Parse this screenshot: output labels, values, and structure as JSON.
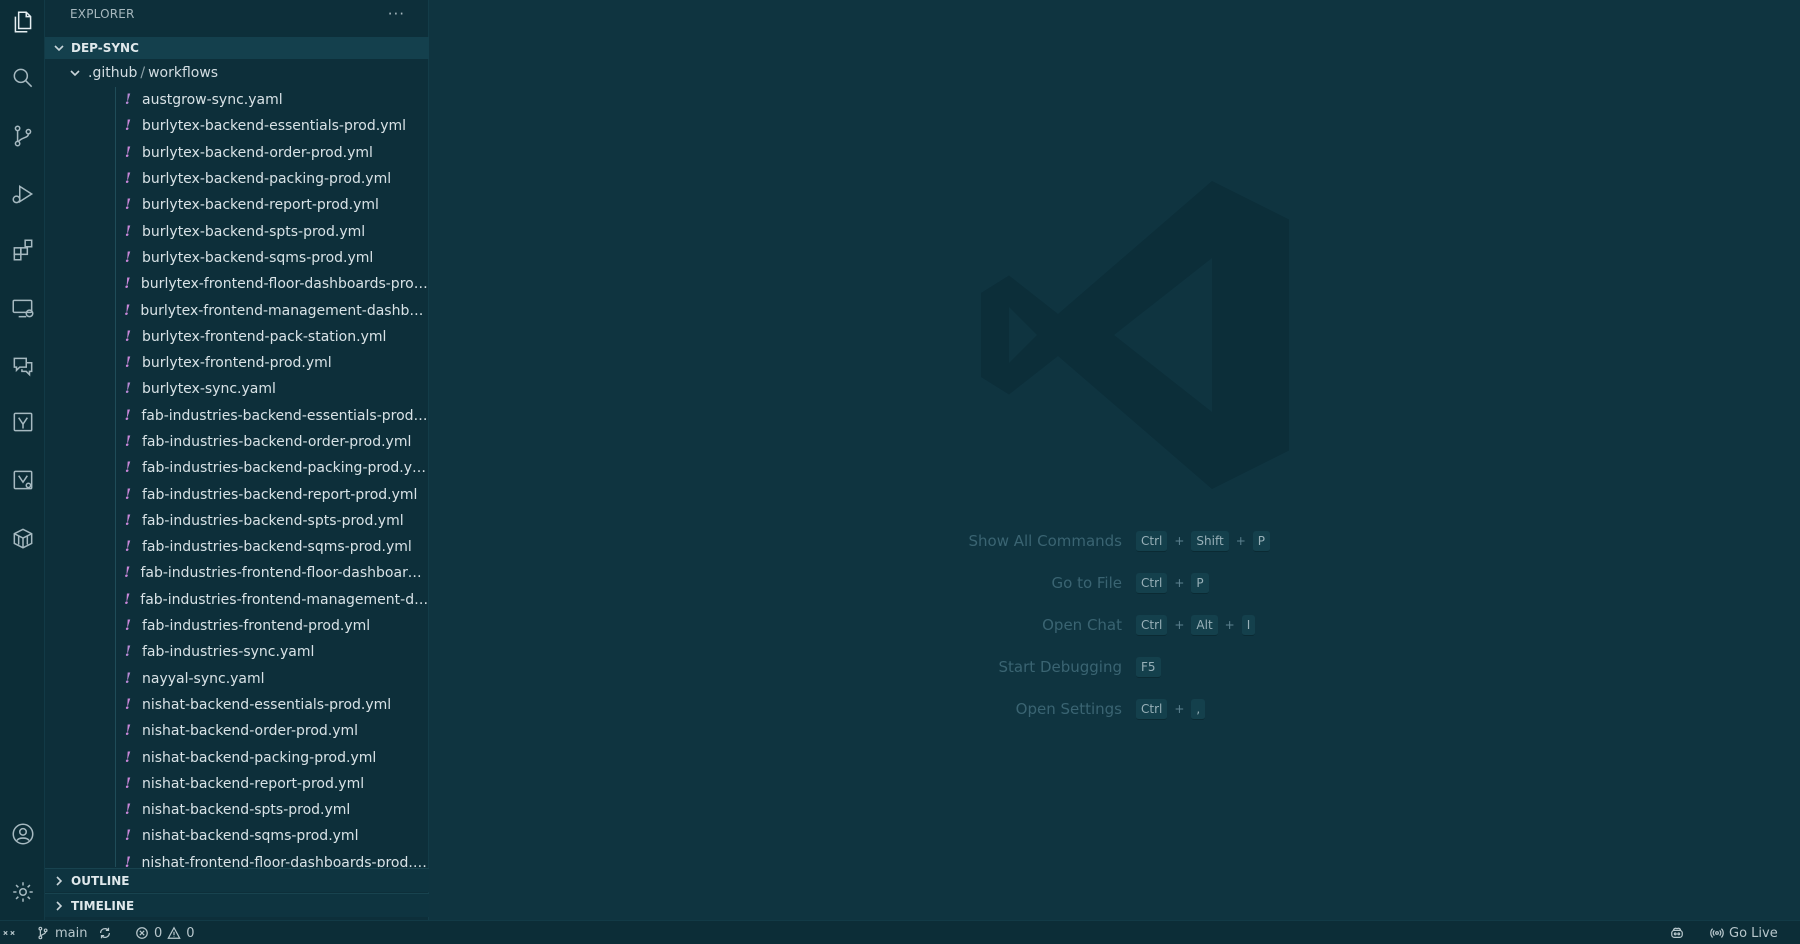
{
  "sidebar": {
    "title": "EXPLORER",
    "more_label": "···",
    "root_folder": "DEP-SYNC",
    "subfolder": {
      "part1": ".github",
      "sep": "/",
      "part2": "workflows"
    },
    "files": [
      {
        "name": "austgrow-sync.yaml",
        "type": "yaml"
      },
      {
        "name": "burlytex-backend-essentials-prod.yml",
        "type": "yml"
      },
      {
        "name": "burlytex-backend-order-prod.yml",
        "type": "yml"
      },
      {
        "name": "burlytex-backend-packing-prod.yml",
        "type": "yml"
      },
      {
        "name": "burlytex-backend-report-prod.yml",
        "type": "yml"
      },
      {
        "name": "burlytex-backend-spts-prod.yml",
        "type": "yml"
      },
      {
        "name": "burlytex-backend-sqms-prod.yml",
        "type": "yml"
      },
      {
        "name": "burlytex-frontend-floor-dashboards-prod.yml",
        "type": "yml"
      },
      {
        "name": "burlytex-frontend-management-dashboards-...",
        "type": "yml"
      },
      {
        "name": "burlytex-frontend-pack-station.yml",
        "type": "yml"
      },
      {
        "name": "burlytex-frontend-prod.yml",
        "type": "yml"
      },
      {
        "name": "burlytex-sync.yaml",
        "type": "yaml"
      },
      {
        "name": "fab-industries-backend-essentials-prod.yml",
        "type": "yml"
      },
      {
        "name": "fab-industries-backend-order-prod.yml",
        "type": "yml"
      },
      {
        "name": "fab-industries-backend-packing-prod.yml",
        "type": "yml"
      },
      {
        "name": "fab-industries-backend-report-prod.yml",
        "type": "yml"
      },
      {
        "name": "fab-industries-backend-spts-prod.yml",
        "type": "yml"
      },
      {
        "name": "fab-industries-backend-sqms-prod.yml",
        "type": "yml"
      },
      {
        "name": "fab-industries-frontend-floor-dashboards-pro...",
        "type": "yml"
      },
      {
        "name": "fab-industries-frontend-management-dashbo...",
        "type": "yml"
      },
      {
        "name": "fab-industries-frontend-prod.yml",
        "type": "yml"
      },
      {
        "name": "fab-industries-sync.yaml",
        "type": "yaml"
      },
      {
        "name": "nayyal-sync.yaml",
        "type": "yaml"
      },
      {
        "name": "nishat-backend-essentials-prod.yml",
        "type": "yml"
      },
      {
        "name": "nishat-backend-order-prod.yml",
        "type": "yml"
      },
      {
        "name": "nishat-backend-packing-prod.yml",
        "type": "yml"
      },
      {
        "name": "nishat-backend-report-prod.yml",
        "type": "yml"
      },
      {
        "name": "nishat-backend-spts-prod.yml",
        "type": "yml"
      },
      {
        "name": "nishat-backend-sqms-prod.yml",
        "type": "yml"
      },
      {
        "name": "nishat-frontend-floor-dashboards-prod.yml",
        "type": "yml"
      }
    ],
    "file_icon_glyph": "!",
    "outline_label": "OUTLINE",
    "timeline_label": "TIMELINE"
  },
  "editor": {
    "shortcuts": [
      {
        "label": "Show All Commands",
        "keys": [
          "Ctrl",
          "Shift",
          "P"
        ]
      },
      {
        "label": "Go to File",
        "keys": [
          "Ctrl",
          "P"
        ]
      },
      {
        "label": "Open Chat",
        "keys": [
          "Ctrl",
          "Alt",
          "I"
        ]
      },
      {
        "label": "Start Debugging",
        "keys": [
          "F5"
        ]
      },
      {
        "label": "Open Settings",
        "keys": [
          "Ctrl",
          ","
        ]
      }
    ],
    "plus": "+"
  },
  "status_bar": {
    "branch": "main",
    "errors": "0",
    "warnings": "0",
    "go_live": "Go Live"
  },
  "activity_bar": {
    "icons": [
      "explorer-icon",
      "search-icon",
      "source-control-icon",
      "run-debug-icon",
      "extensions-icon",
      "remote-explorer-icon",
      "chat-icon",
      "azure-icon",
      "azure-devops-icon",
      "containers-icon",
      "account-icon",
      "settings-gear-icon"
    ]
  },
  "colors": {
    "background": "#0f3440",
    "sidebar": "#0d2f3a",
    "yaml_icon": "#c987d9"
  }
}
